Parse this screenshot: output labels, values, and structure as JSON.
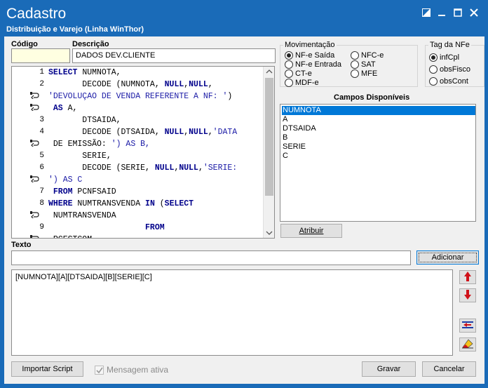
{
  "window": {
    "title": "Cadastro",
    "subtitle": "Distribuição e Varejo (Linha WinThor)"
  },
  "fields": {
    "codigo_label": "Código",
    "codigo_value": "",
    "descricao_label": "Descrição",
    "descricao_value": "DADOS DEV.CLIENTE"
  },
  "script": {
    "line_numbers": [
      "1",
      "2",
      "",
      "",
      "3",
      "4",
      "",
      "5",
      "6",
      "",
      "7",
      "8",
      "",
      "9",
      ""
    ],
    "lines": [
      "SELECT NUMNOTA,",
      "       DECODE (NUMNOTA, NULL,NULL,",
      "'DEVOLUÇAO DE VENDA REFERENTE A NF: ')",
      " AS A,",
      "       DTSAIDA,",
      "       DECODE (DTSAIDA, NULL,NULL,'DATA",
      " DE EMISSÃO: ') AS B,",
      "       SERIE,",
      "       DECODE (SERIE, NULL,NULL,'SERIE:",
      "') AS C",
      " FROM PCNFSAID",
      "WHERE NUMTRANSVENDA IN (SELECT",
      " NUMTRANSVENDA",
      "                    FROM",
      " PCESTCOM"
    ]
  },
  "movimentacao": {
    "title": "Movimentação",
    "options": [
      {
        "label": "NF-e Saída",
        "selected": true
      },
      {
        "label": "NFC-e",
        "selected": false
      },
      {
        "label": "NF-e Entrada",
        "selected": false
      },
      {
        "label": "SAT",
        "selected": false
      },
      {
        "label": "CT-e",
        "selected": false
      },
      {
        "label": "MFE",
        "selected": false
      },
      {
        "label": "MDF-e",
        "selected": false
      }
    ]
  },
  "tag_nfe": {
    "title": "Tag da NFe",
    "options": [
      {
        "label": "infCpl",
        "selected": true
      },
      {
        "label": "obsFisco",
        "selected": false
      },
      {
        "label": "obsCont",
        "selected": false
      }
    ]
  },
  "campos": {
    "title": "Campos Disponíveis",
    "items": [
      "NUMNOTA",
      "A",
      "DTSAIDA",
      "B",
      "SERIE",
      "C"
    ],
    "selected_index": 0
  },
  "buttons": {
    "atribuir": "Atribuir",
    "adicionar": "Adicionar",
    "importar": "Importar Script",
    "gravar": "Gravar",
    "cancelar": "Cancelar"
  },
  "texto": {
    "label": "Texto",
    "value": "",
    "result": "[NUMNOTA][A][DTSAIDA][B][SERIE][C]"
  },
  "mensagem_ativa": {
    "label": "Mensagem ativa",
    "checked": true
  },
  "icons": {
    "up": "arrow-up-icon",
    "down": "arrow-down-icon",
    "insert": "insert-field-icon",
    "clear": "eraser-icon"
  },
  "colors": {
    "titlebar": "#1a6bb8",
    "selection": "#0078d7",
    "arrow_red": "#d0121a"
  }
}
